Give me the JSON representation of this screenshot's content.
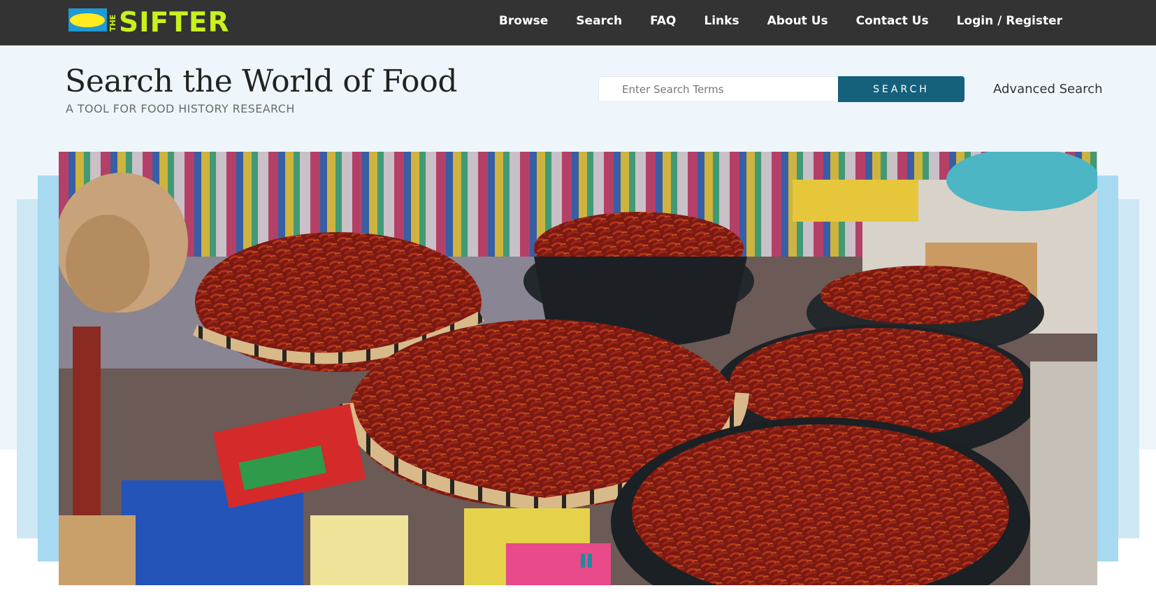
{
  "brand": {
    "logo_the": "THE",
    "logo_name": "SIFTER",
    "logo_colors": {
      "ellipse": "#ffeb1f",
      "box": "#1e9ad6",
      "text": "#c8f21c"
    }
  },
  "nav": {
    "items": [
      {
        "label": "Browse"
      },
      {
        "label": "Search"
      },
      {
        "label": "FAQ"
      },
      {
        "label": "Links"
      },
      {
        "label": "About Us"
      },
      {
        "label": "Contact Us"
      },
      {
        "label": "Login / Register"
      }
    ]
  },
  "header": {
    "title": "Search the World of Food",
    "subtitle": "A TOOL FOR FOOD HISTORY RESEARCH"
  },
  "search": {
    "placeholder": "Enter Search Terms",
    "value": "",
    "button_label": "SEARCH",
    "advanced_label": "Advanced Search"
  },
  "hero": {
    "pause_icon": "pause-icon"
  },
  "colors": {
    "nav_bg": "#333333",
    "band_bg": "#eef6fc",
    "accent": "#15617c",
    "frame_light": "#cde7f5",
    "frame_mid": "#a7d9f0"
  }
}
